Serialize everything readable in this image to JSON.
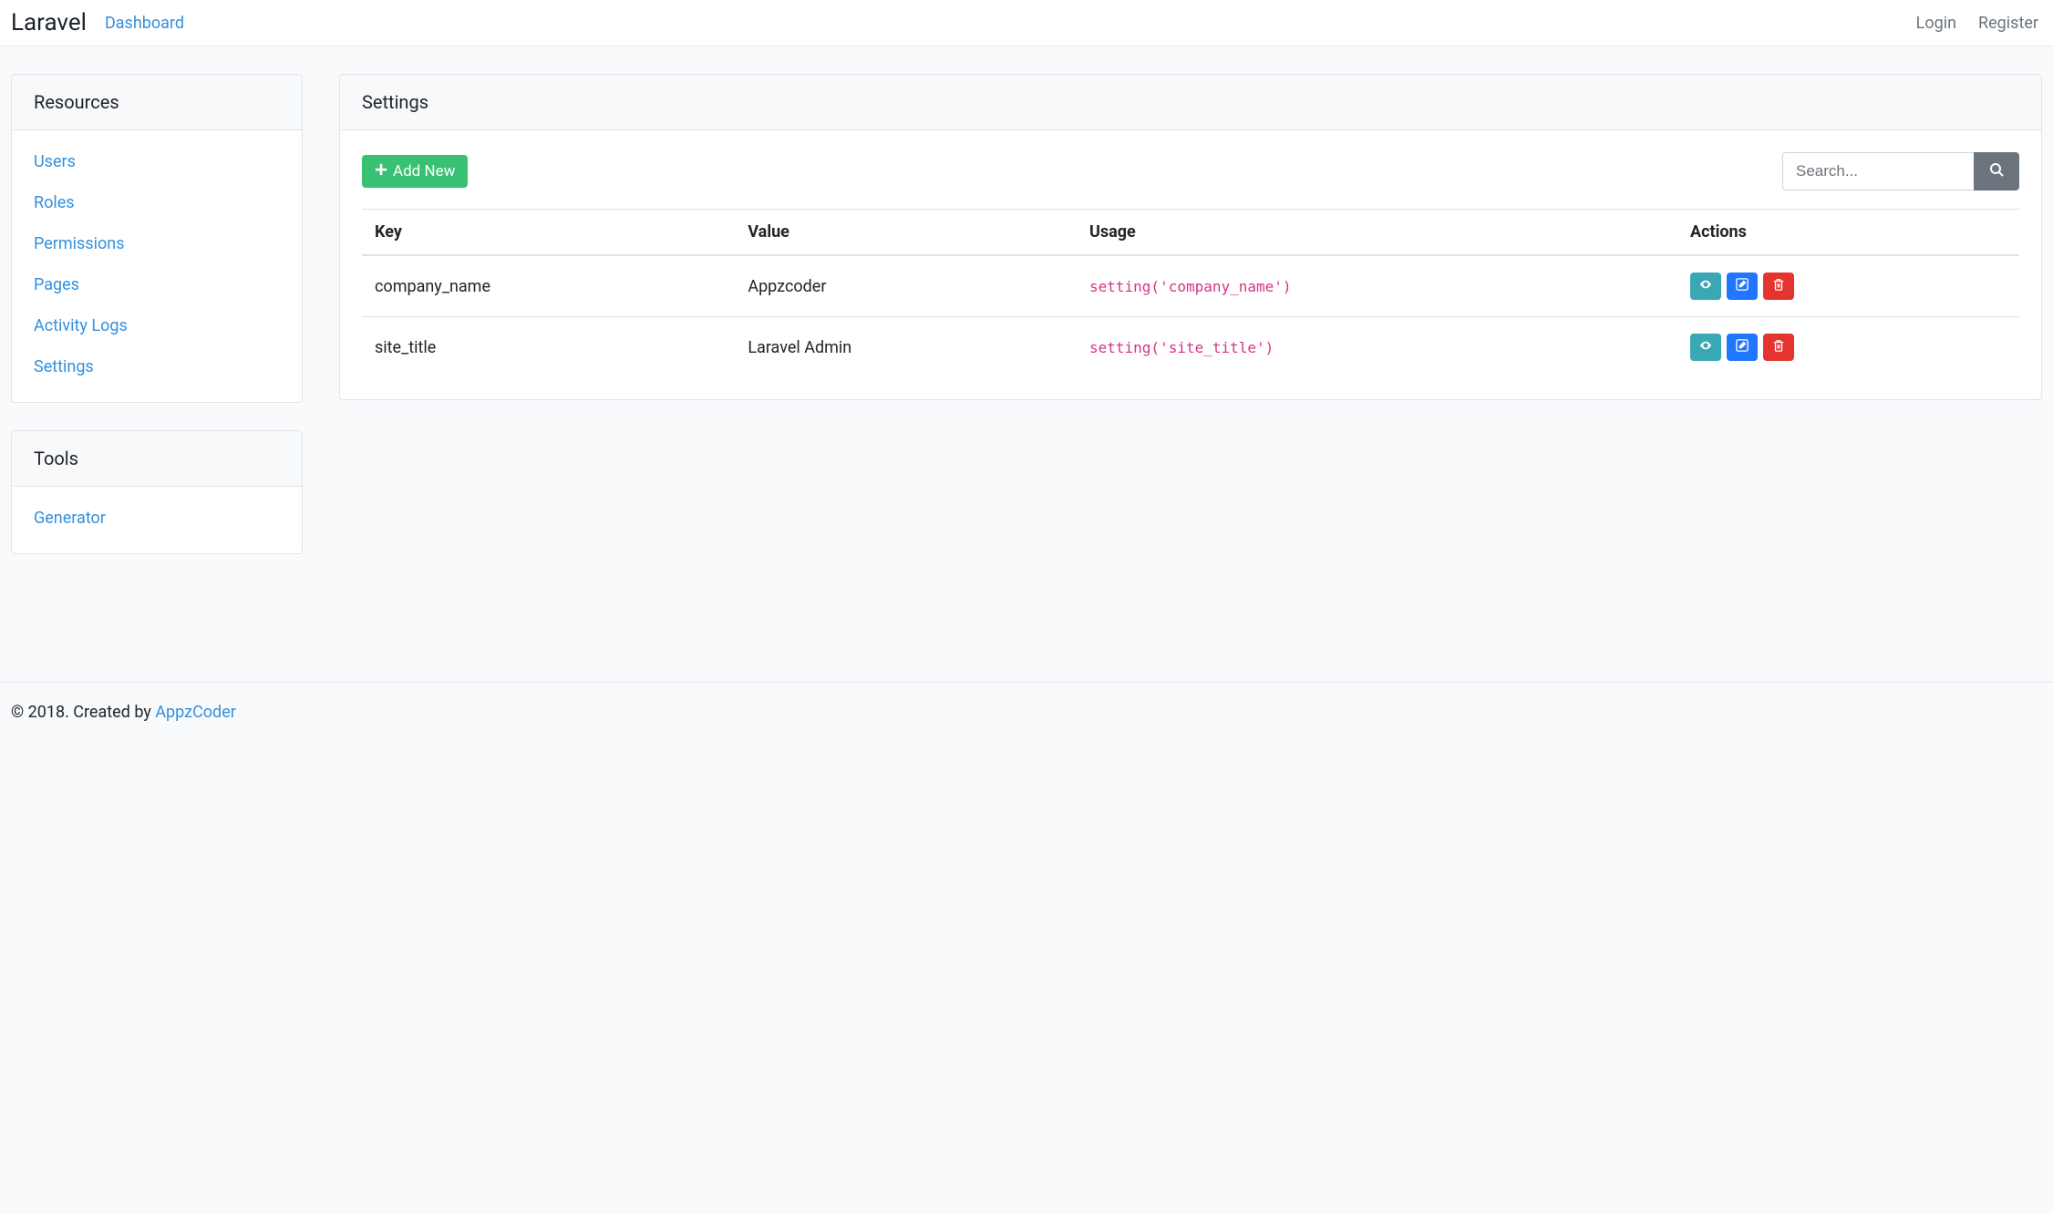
{
  "navbar": {
    "brand": "Laravel",
    "dashboard": "Dashboard",
    "login": "Login",
    "register": "Register"
  },
  "sidebar": {
    "resources_title": "Resources",
    "resources_items": [
      "Users",
      "Roles",
      "Permissions",
      "Pages",
      "Activity Logs",
      "Settings"
    ],
    "tools_title": "Tools",
    "tools_items": [
      "Generator"
    ]
  },
  "main": {
    "title": "Settings",
    "add_new_label": "Add New",
    "search_placeholder": "Search...",
    "columns": [
      "Key",
      "Value",
      "Usage",
      "Actions"
    ],
    "rows": [
      {
        "key": "company_name",
        "value": "Appzcoder",
        "usage": "setting('company_name')"
      },
      {
        "key": "site_title",
        "value": "Laravel Admin",
        "usage": "setting('site_title')"
      }
    ]
  },
  "footer": {
    "prefix": "© 2018. Created by ",
    "link": "AppzCoder"
  }
}
